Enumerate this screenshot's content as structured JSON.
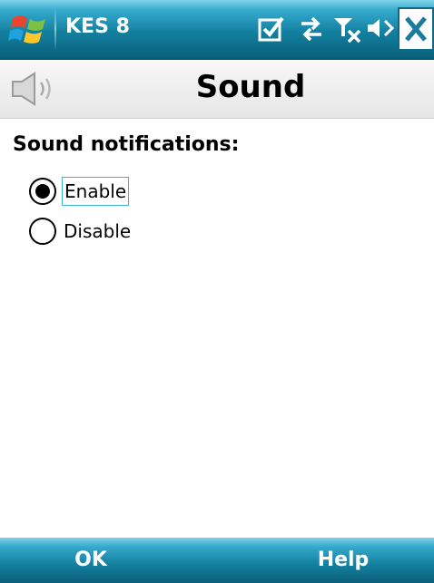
{
  "titlebar": {
    "app_title": "KES 8",
    "icons": [
      "windows-start-icon",
      "checkbox-notification-icon",
      "data-connection-icon",
      "no-signal-icon",
      "volume-icon",
      "close-icon"
    ]
  },
  "header": {
    "title": "Sound",
    "icon": "speaker-icon"
  },
  "content": {
    "section_label": "Sound notifications:",
    "options": [
      {
        "label": "Enable",
        "selected": true
      },
      {
        "label": "Disable",
        "selected": false
      }
    ]
  },
  "softkeys": {
    "left": "OK",
    "right": "Help"
  },
  "colors": {
    "bar_dark": "#0a5f79",
    "bar_light": "#35a9cc",
    "focus_border": "#3cb6d6"
  }
}
